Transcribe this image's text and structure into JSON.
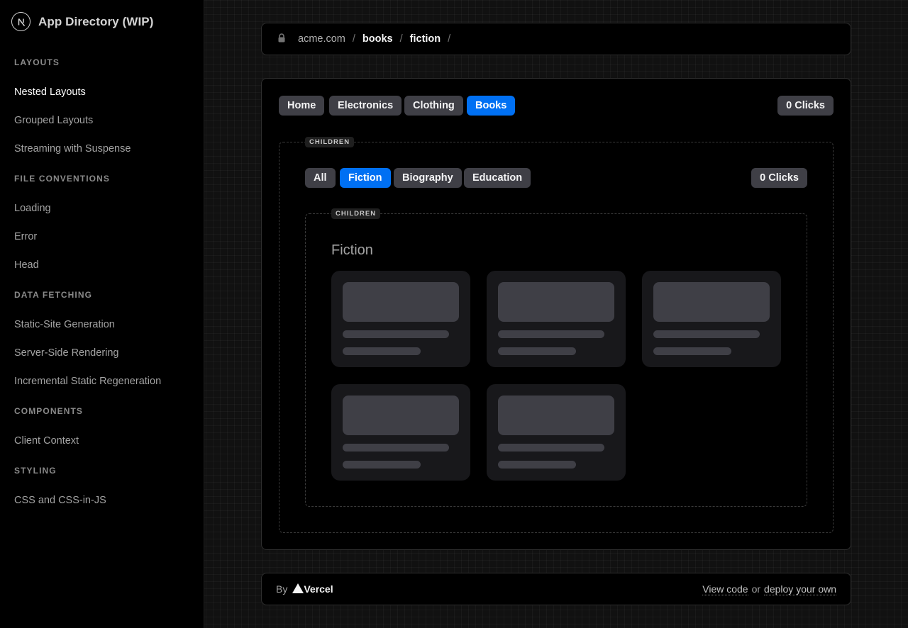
{
  "sidebar": {
    "title": "App Directory (WIP)",
    "logo_icon": "nextjs-logo-icon",
    "sections": [
      {
        "heading": "LAYOUTS",
        "items": [
          "Nested Layouts",
          "Grouped Layouts",
          "Streaming with Suspense"
        ]
      },
      {
        "heading": "FILE CONVENTIONS",
        "items": [
          "Loading",
          "Error",
          "Head"
        ]
      },
      {
        "heading": "DATA FETCHING",
        "items": [
          "Static-Site Generation",
          "Server-Side Rendering",
          "Incremental Static Regeneration"
        ]
      },
      {
        "heading": "COMPONENTS",
        "items": [
          "Client Context"
        ]
      },
      {
        "heading": "STYLING",
        "items": [
          "CSS and CSS-in-JS"
        ]
      }
    ],
    "active_item": "Nested Layouts"
  },
  "urlbar": {
    "lock_icon": "lock-icon",
    "domain": "acme.com",
    "separator": "/",
    "segments": [
      "books",
      "fiction"
    ]
  },
  "layout": {
    "tabs": [
      "Home",
      "Electronics",
      "Clothing",
      "Books"
    ],
    "active_tab": "Books",
    "clicks": "0 Clicks",
    "children_label": "CHILDREN"
  },
  "nested": {
    "tabs": [
      "All",
      "Fiction",
      "Biography",
      "Education"
    ],
    "active_tab": "Fiction",
    "clicks": "0 Clicks",
    "children_label": "CHILDREN",
    "section_title": "Fiction",
    "skeleton_count": 5
  },
  "footer": {
    "by": "By",
    "brand": "Vercel",
    "view_code": "View code",
    "or": "or",
    "deploy": "deploy your own"
  },
  "colors": {
    "accent": "#0070f3",
    "pill": "#3f3f46",
    "card": "#18181b"
  }
}
